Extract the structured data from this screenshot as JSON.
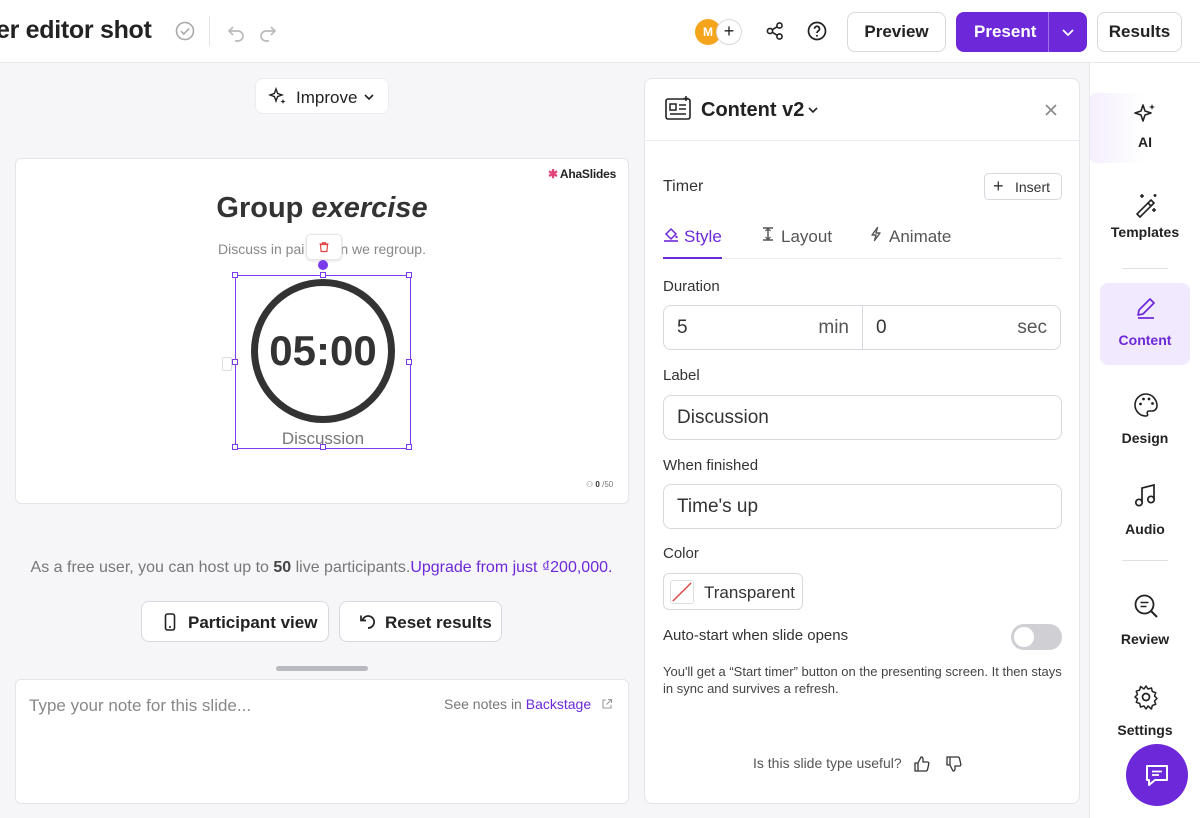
{
  "header": {
    "doc_title": "er editor shot",
    "avatar_initial": "M",
    "add_collaborator": "+",
    "preview_label": "Preview",
    "present_label": "Present",
    "results_label": "Results"
  },
  "improve": {
    "label": "Improve"
  },
  "slide": {
    "brand": "AhaSlides",
    "title_main": "Group ",
    "title_italic": "exercise",
    "subtitle_left": "Discuss in pai",
    "subtitle_right": "n we regroup.",
    "timer_value": "05:00",
    "timer_label": "Discussion",
    "response_count": "0",
    "response_max": "/50"
  },
  "upsell": {
    "text_before": "As a free user, you can host up to ",
    "limit": "50",
    "text_after": " live participants.",
    "link": "Upgrade from just ₫200,000."
  },
  "actions": {
    "participant_view": "Participant view",
    "reset_results": "Reset results"
  },
  "notes": {
    "placeholder": "Type your note for this slide...",
    "see_notes_prefix": "See notes in ",
    "backstage_link": "Backstage"
  },
  "panel": {
    "title": "Content v2",
    "timer_section": "Timer",
    "insert_label": "Insert",
    "tabs": [
      {
        "label": "Style",
        "icon": "paint-bucket-icon",
        "active": true
      },
      {
        "label": "Layout",
        "icon": "text-cursor-icon",
        "active": false
      },
      {
        "label": "Animate",
        "icon": "lightning-icon",
        "active": false
      }
    ],
    "duration_label": "Duration",
    "duration_min": "5",
    "duration_min_unit": "min",
    "duration_sec": "0",
    "duration_sec_unit": "sec",
    "label_label": "Label",
    "label_value": "Discussion",
    "when_finished_label": "When finished",
    "when_finished_value": "Time's up",
    "color_label": "Color",
    "color_value": "Transparent",
    "autostart_label": "Auto-start when slide opens",
    "autostart_on": false,
    "autostart_help": "You'll get a “Start timer” button on the presenting screen. It then stays in sync and survives a refresh.",
    "feedback_question": "Is this slide type useful?"
  },
  "sidebar": {
    "items": [
      {
        "label": "AI",
        "icon": "sparkles-icon"
      },
      {
        "label": "Templates",
        "icon": "magic-wand-icon"
      },
      {
        "label": "Content",
        "icon": "pencil-icon",
        "active": true
      },
      {
        "label": "Design",
        "icon": "palette-icon"
      },
      {
        "label": "Audio",
        "icon": "music-note-icon"
      },
      {
        "label": "Review",
        "icon": "search-review-icon"
      },
      {
        "label": "Settings",
        "icon": "gear-icon"
      }
    ]
  },
  "colors": {
    "accent": "#6d28d9",
    "avatar": "#f4a51c",
    "brand_mark": "#e0457b"
  }
}
